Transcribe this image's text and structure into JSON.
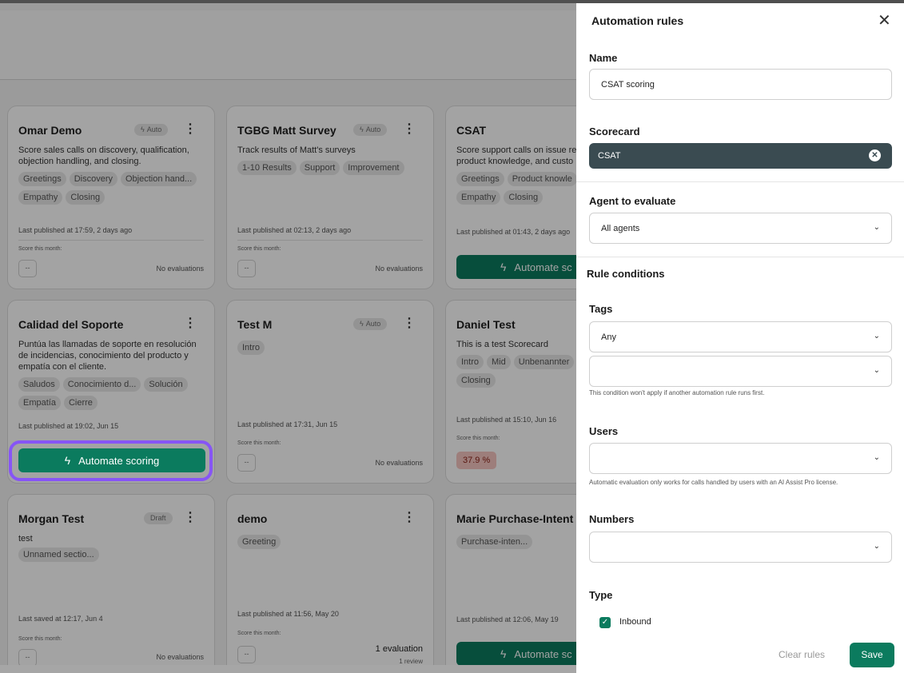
{
  "cards": [
    {
      "title": "Omar Demo",
      "badge": "Auto",
      "desc": "Score sales calls on discovery, qualification, objection handling, and closing.",
      "tags": [
        "Greetings",
        "Discovery",
        "Objection hand...",
        "Empathy",
        "Closing"
      ],
      "published": "Last published at 17:59, 2 days ago",
      "score_label": "Score this month:",
      "score": "--",
      "evals": "No evaluations"
    },
    {
      "title": "TGBG Matt Survey",
      "badge": "Auto",
      "desc": "Track results of Matt's surveys",
      "tags": [
        "1-10 Results",
        "Support",
        "Improvement"
      ],
      "published": "Last published at 02:13, 2 days ago",
      "score_label": "Score this month:",
      "score": "--",
      "evals": "No evaluations"
    },
    {
      "title": "CSAT",
      "desc": "Score support calls on issue re product knowledge, and custo",
      "tags": [
        "Greetings",
        "Product knowle",
        "Empathy",
        "Closing"
      ],
      "published": "Last published at 01:43, 2 days ago",
      "button": "Automate sc"
    },
    {
      "title": "Calidad del Soporte",
      "desc": "Puntúa las llamadas de soporte en resolución de incidencias, conocimiento del producto y empatía con el cliente.",
      "tags": [
        "Saludos",
        "Conocimiento d...",
        "Solución",
        "Empatía",
        "Cierre"
      ],
      "published": "Last published at 19:02, Jun 15",
      "button": "Automate scoring"
    },
    {
      "title": "Test M",
      "badge": "Auto",
      "tags": [
        "Intro"
      ],
      "published": "Last published at 17:31, Jun 15",
      "score_label": "Score this month:",
      "score": "--",
      "evals": "No evaluations"
    },
    {
      "title": "Daniel Test",
      "desc": "This is a test Scorecard",
      "tags": [
        "Intro",
        "Mid",
        "Unbenannter",
        "Closing"
      ],
      "published": "Last published at 15:10, Jun 16",
      "score_label": "Score this month:",
      "score": "37.9 %"
    },
    {
      "title": "Morgan Test",
      "badge": "Draft",
      "desc": "test",
      "tags": [
        "Unnamed sectio..."
      ],
      "published": "Last saved at 12:17, Jun 4",
      "score_label": "Score this month:",
      "score": "--",
      "evals": "No evaluations"
    },
    {
      "title": "demo",
      "tags": [
        "Greeting"
      ],
      "published": "Last published at 11:56, May 20",
      "score_label": "Score this month:",
      "score": "--",
      "evals": "1 evaluation",
      "reviews": "1 review"
    },
    {
      "title": "Marie Purchase-Intent T",
      "tags": [
        "Purchase-inten..."
      ],
      "published": "Last published at 12:06, May 19",
      "button": "Automate sc"
    }
  ],
  "panel": {
    "title": "Automation rules",
    "name_label": "Name",
    "name_value": "CSAT scoring",
    "scorecard_label": "Scorecard",
    "scorecard_value": "CSAT",
    "agent_label": "Agent to evaluate",
    "agent_value": "All agents",
    "conditions_label": "Rule conditions",
    "tags_label": "Tags",
    "tags_value": "Any",
    "tags_hint": "This condition won't apply if another automation rule runs first.",
    "users_label": "Users",
    "users_hint": "Automatic evaluation only works for calls handled by users with an AI Assist Pro license.",
    "numbers_label": "Numbers",
    "type_label": "Type",
    "type_option": "Inbound",
    "clear_label": "Clear rules",
    "save_label": "Save"
  },
  "icons": {
    "close": "close-icon",
    "bolt": "lightning-icon",
    "kebab": "more-vertical-icon",
    "chevron": "chevron-down-icon",
    "check": "check-icon"
  },
  "colors": {
    "accent": "#0b7b5e",
    "highlight": "#8755f5",
    "chip": "#3a4b51"
  }
}
